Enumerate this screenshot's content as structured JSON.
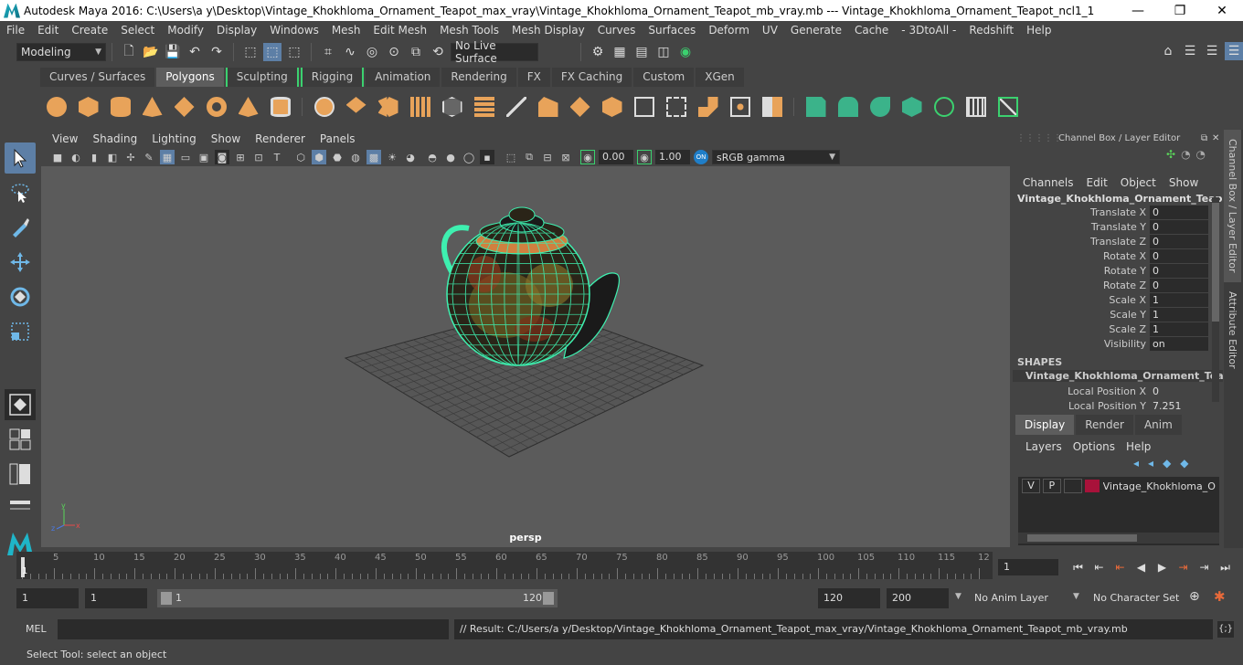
{
  "window": {
    "title": "Autodesk Maya 2016: C:\\Users\\a y\\Desktop\\Vintage_Khokhloma_Ornament_Teapot_max_vray\\Vintage_Khokhloma_Ornament_Teapot_mb_vray.mb    ---    Vintage_Khokhloma_Ornament_Teapot_ncl1_1",
    "minimize": "—",
    "maximize": "❐",
    "close": "✕"
  },
  "menu": [
    "File",
    "Edit",
    "Create",
    "Select",
    "Modify",
    "Display",
    "Windows",
    "Mesh",
    "Edit Mesh",
    "Mesh Tools",
    "Mesh Display",
    "Curves",
    "Surfaces",
    "Deform",
    "UV",
    "Generate",
    "Cache",
    "- 3DtoAll -",
    "Redshift",
    "Help"
  ],
  "status": {
    "menuset": "Modeling",
    "live_surface": "No Live Surface"
  },
  "shelf": {
    "tabs": [
      "Curves / Surfaces",
      "Polygons",
      "Sculpting",
      "Rigging",
      "Animation",
      "Rendering",
      "FX",
      "FX Caching",
      "Custom",
      "XGen"
    ],
    "active_tab": "Polygons"
  },
  "panel": {
    "menu": [
      "View",
      "Shading",
      "Lighting",
      "Show",
      "Renderer",
      "Panels"
    ],
    "exposure": "0.00",
    "gamma": "1.00",
    "color_space": "sRGB gamma",
    "camera": "persp"
  },
  "channel_box": {
    "header": "Channel Box / Layer Editor",
    "menu": [
      "Channels",
      "Edit",
      "Object",
      "Show"
    ],
    "object": "Vintage_Khokhloma_Ornament_Teapo...",
    "attributes": [
      {
        "label": "Translate X",
        "value": "0"
      },
      {
        "label": "Translate Y",
        "value": "0"
      },
      {
        "label": "Translate Z",
        "value": "0"
      },
      {
        "label": "Rotate X",
        "value": "0"
      },
      {
        "label": "Rotate Y",
        "value": "0"
      },
      {
        "label": "Rotate Z",
        "value": "0"
      },
      {
        "label": "Scale X",
        "value": "1"
      },
      {
        "label": "Scale Y",
        "value": "1"
      },
      {
        "label": "Scale Z",
        "value": "1"
      },
      {
        "label": "Visibility",
        "value": "on"
      }
    ],
    "shapes_label": "SHAPES",
    "shape_name": "Vintage_Khokhloma_Ornament_Tea...",
    "shape_attributes": [
      {
        "label": "Local Position X",
        "value": "0"
      },
      {
        "label": "Local Position Y",
        "value": "7.251"
      }
    ]
  },
  "layer_editor": {
    "tabs": [
      "Display",
      "Render",
      "Anim"
    ],
    "active_tab": "Display",
    "menu": [
      "Layers",
      "Options",
      "Help"
    ],
    "layer": {
      "v": "V",
      "p": "P",
      "name": "Vintage_Khokhloma_Orn",
      "color": "#a8123a"
    }
  },
  "side_tabs": [
    "Channel Box / Layer Editor",
    "Attribute Editor"
  ],
  "timeline": {
    "ticks": [
      "5",
      "10",
      "15",
      "20",
      "25",
      "30",
      "35",
      "40",
      "45",
      "50",
      "55",
      "60",
      "65",
      "70",
      "75",
      "80",
      "85",
      "90",
      "95",
      "100",
      "105",
      "110",
      "115",
      "12"
    ],
    "start_marker": "1",
    "current_frame": "1"
  },
  "range": {
    "start": "1",
    "playback_start": "1",
    "slider_start": "1",
    "slider_end": "120",
    "playback_end": "120",
    "end": "200",
    "anim_layer": "No Anim Layer",
    "character_set": "No Character Set"
  },
  "command": {
    "label": "MEL",
    "result": "// Result: C:/Users/a y/Desktop/Vintage_Khokhloma_Ornament_Teapot_max_vray/Vintage_Khokhloma_Ornament_Teapot_mb_vray.mb"
  },
  "help_line": "Select Tool: select an object"
}
